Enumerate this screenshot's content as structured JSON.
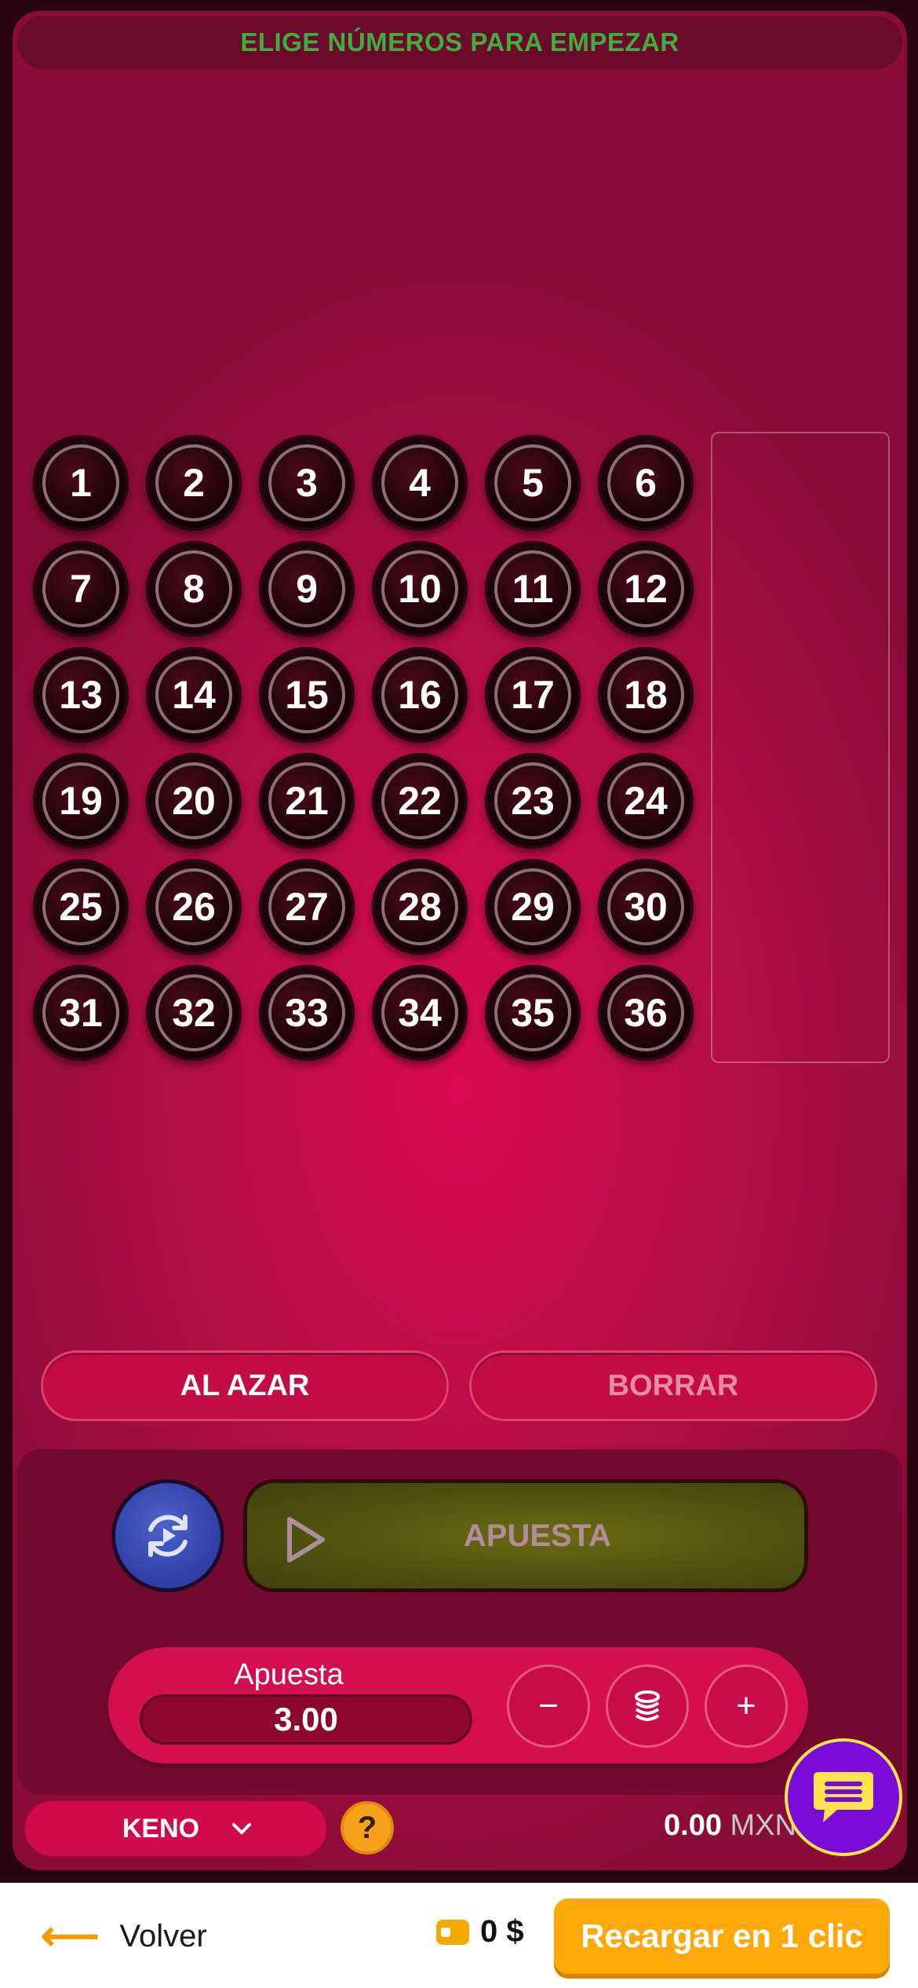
{
  "banner": {
    "text": "ELIGE NÚMEROS PARA EMPEZAR"
  },
  "numbers": [
    "1",
    "2",
    "3",
    "4",
    "5",
    "6",
    "7",
    "8",
    "9",
    "10",
    "11",
    "12",
    "13",
    "14",
    "15",
    "16",
    "17",
    "18",
    "19",
    "20",
    "21",
    "22",
    "23",
    "24",
    "25",
    "26",
    "27",
    "28",
    "29",
    "30",
    "31",
    "32",
    "33",
    "34",
    "35",
    "36"
  ],
  "actions": {
    "random_label": "AL AZAR",
    "clear_label": "BORRAR"
  },
  "bet": {
    "button_label": "APUESTA",
    "stake_label": "Apuesta MXN",
    "stake_value": "3.00",
    "minus": "−",
    "plus": "+"
  },
  "footer": {
    "game_name": "KENO",
    "help": "?",
    "balance_value": "0.00",
    "balance_currency": "MXN"
  },
  "bottom": {
    "back_arrow": "⟵",
    "back_label": "Volver",
    "wallet_amount": "0 $",
    "recharge_label": "Recargar en 1 clic"
  },
  "icons": {
    "auto": "autoplay-icon",
    "play": "play-icon",
    "coins": "coins-icon",
    "chevron": "chevron-down-icon",
    "chat": "chat-icon",
    "wallet": "wallet-icon"
  },
  "colors": {
    "accent": "#d40f50",
    "banner_text": "#3fae3f",
    "recharge": "#ffa80a"
  }
}
